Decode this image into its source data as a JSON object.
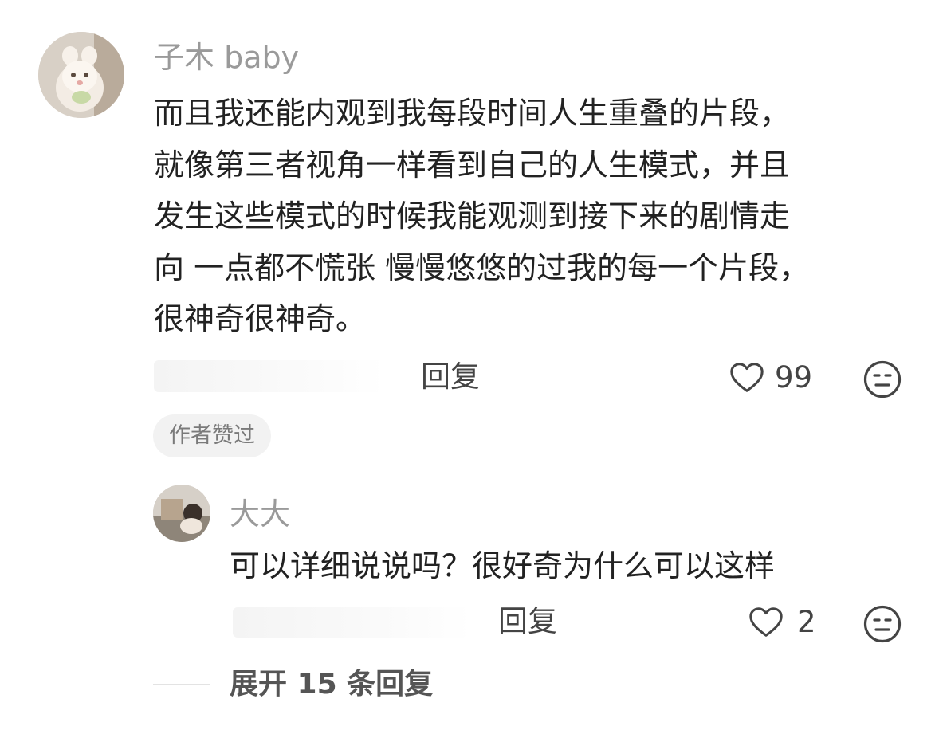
{
  "comment": {
    "username": "子木 baby",
    "text_lines": [
      "而且我还能内观到我每段时间人生重叠的片段，",
      "就像第三者视角一样看到自己的人生模式，并且",
      "发生这些模式的时候我能观测到接下来的剧情走",
      "向 一点都不慌张 慢慢悠悠的过我的每一个片段，",
      "很神奇很神奇。"
    ],
    "reply_label": "回复",
    "like_count": "99",
    "author_badge": "作者赞过"
  },
  "reply": {
    "username": "大大",
    "text": "可以详细说说吗？很好奇为什么可以这样",
    "reply_label": "回复",
    "like_count": "2"
  },
  "expand": {
    "label": "展开 15 条回复"
  },
  "icons": {
    "like": "heart-outline-icon",
    "dislike": "meh-face-icon"
  },
  "colors": {
    "text_primary": "#222222",
    "text_secondary": "#9a9a9a",
    "icon": "#444444",
    "badge_bg": "#f2f2f2"
  }
}
